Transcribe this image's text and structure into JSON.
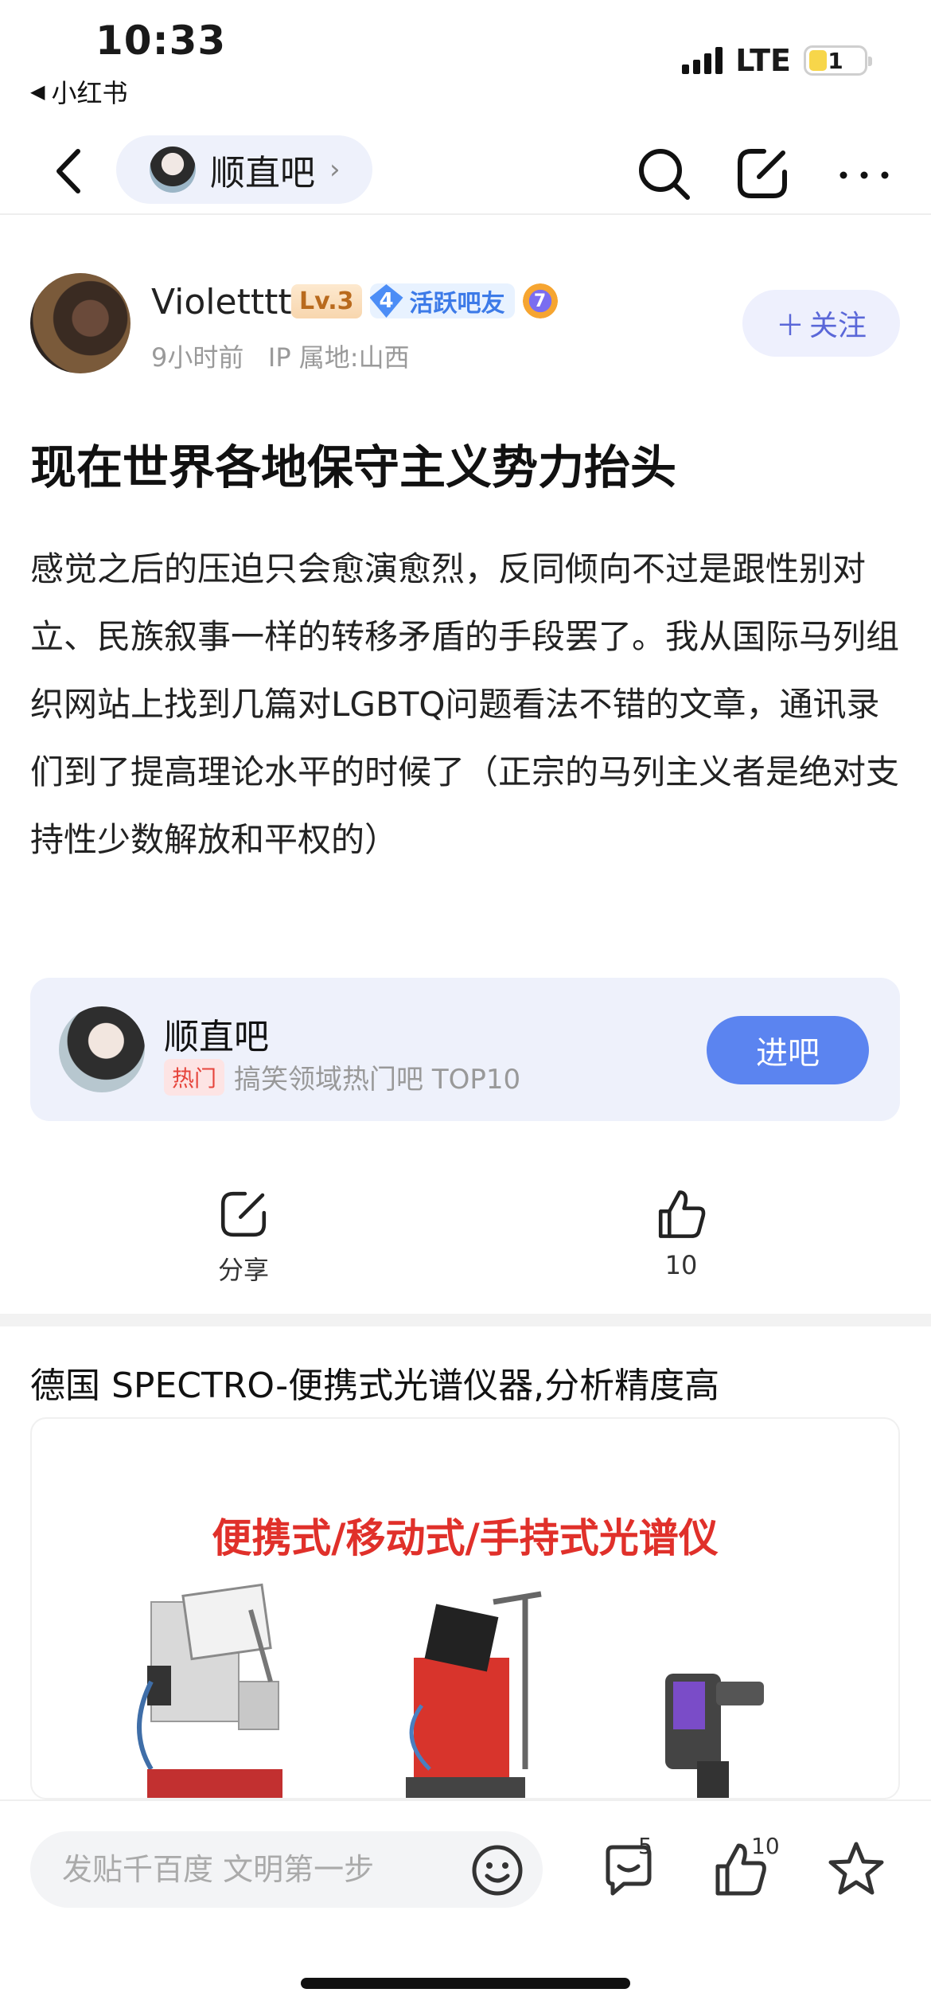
{
  "status_bar": {
    "time": "10:33",
    "back_app": "小红书",
    "network": "LTE",
    "battery": "1"
  },
  "nav": {
    "forum_name": "顺直吧"
  },
  "author": {
    "name": "Violetttt",
    "level": "Lv.3",
    "active_level": "4",
    "active_label": "活跃吧友",
    "badge_number": "7",
    "time": "9小时前",
    "ip": "IP 属地:山西",
    "follow_label": "关注"
  },
  "post": {
    "title": "现在世界各地保守主义势力抬头",
    "body": "感觉之后的压迫只会愈演愈烈，反同倾向不过是跟性别对立、民族叙事一样的转移矛盾的手段罢了。我从国际马列组织网站上找到几篇对LGBTQ问题看法不错的文章，通讯录们到了提高理论水平的时候了（正宗的马列主义者是绝对支持性少数解放和平权的）"
  },
  "forum_card": {
    "name": "顺直吧",
    "hot_tag": "热门",
    "hot_text": "搞笑领域热门吧 TOP10",
    "enter_label": "进吧"
  },
  "actions": {
    "share_label": "分享",
    "like_count": "10"
  },
  "ad": {
    "title": "德国 SPECTRO-便携式光谱仪器,分析精度高",
    "banner": "便携式/移动式/手持式光谱仪"
  },
  "bottom_bar": {
    "input_placeholder": "发贴千百度 文明第一步",
    "comment_count": "5",
    "like_count": "10"
  }
}
